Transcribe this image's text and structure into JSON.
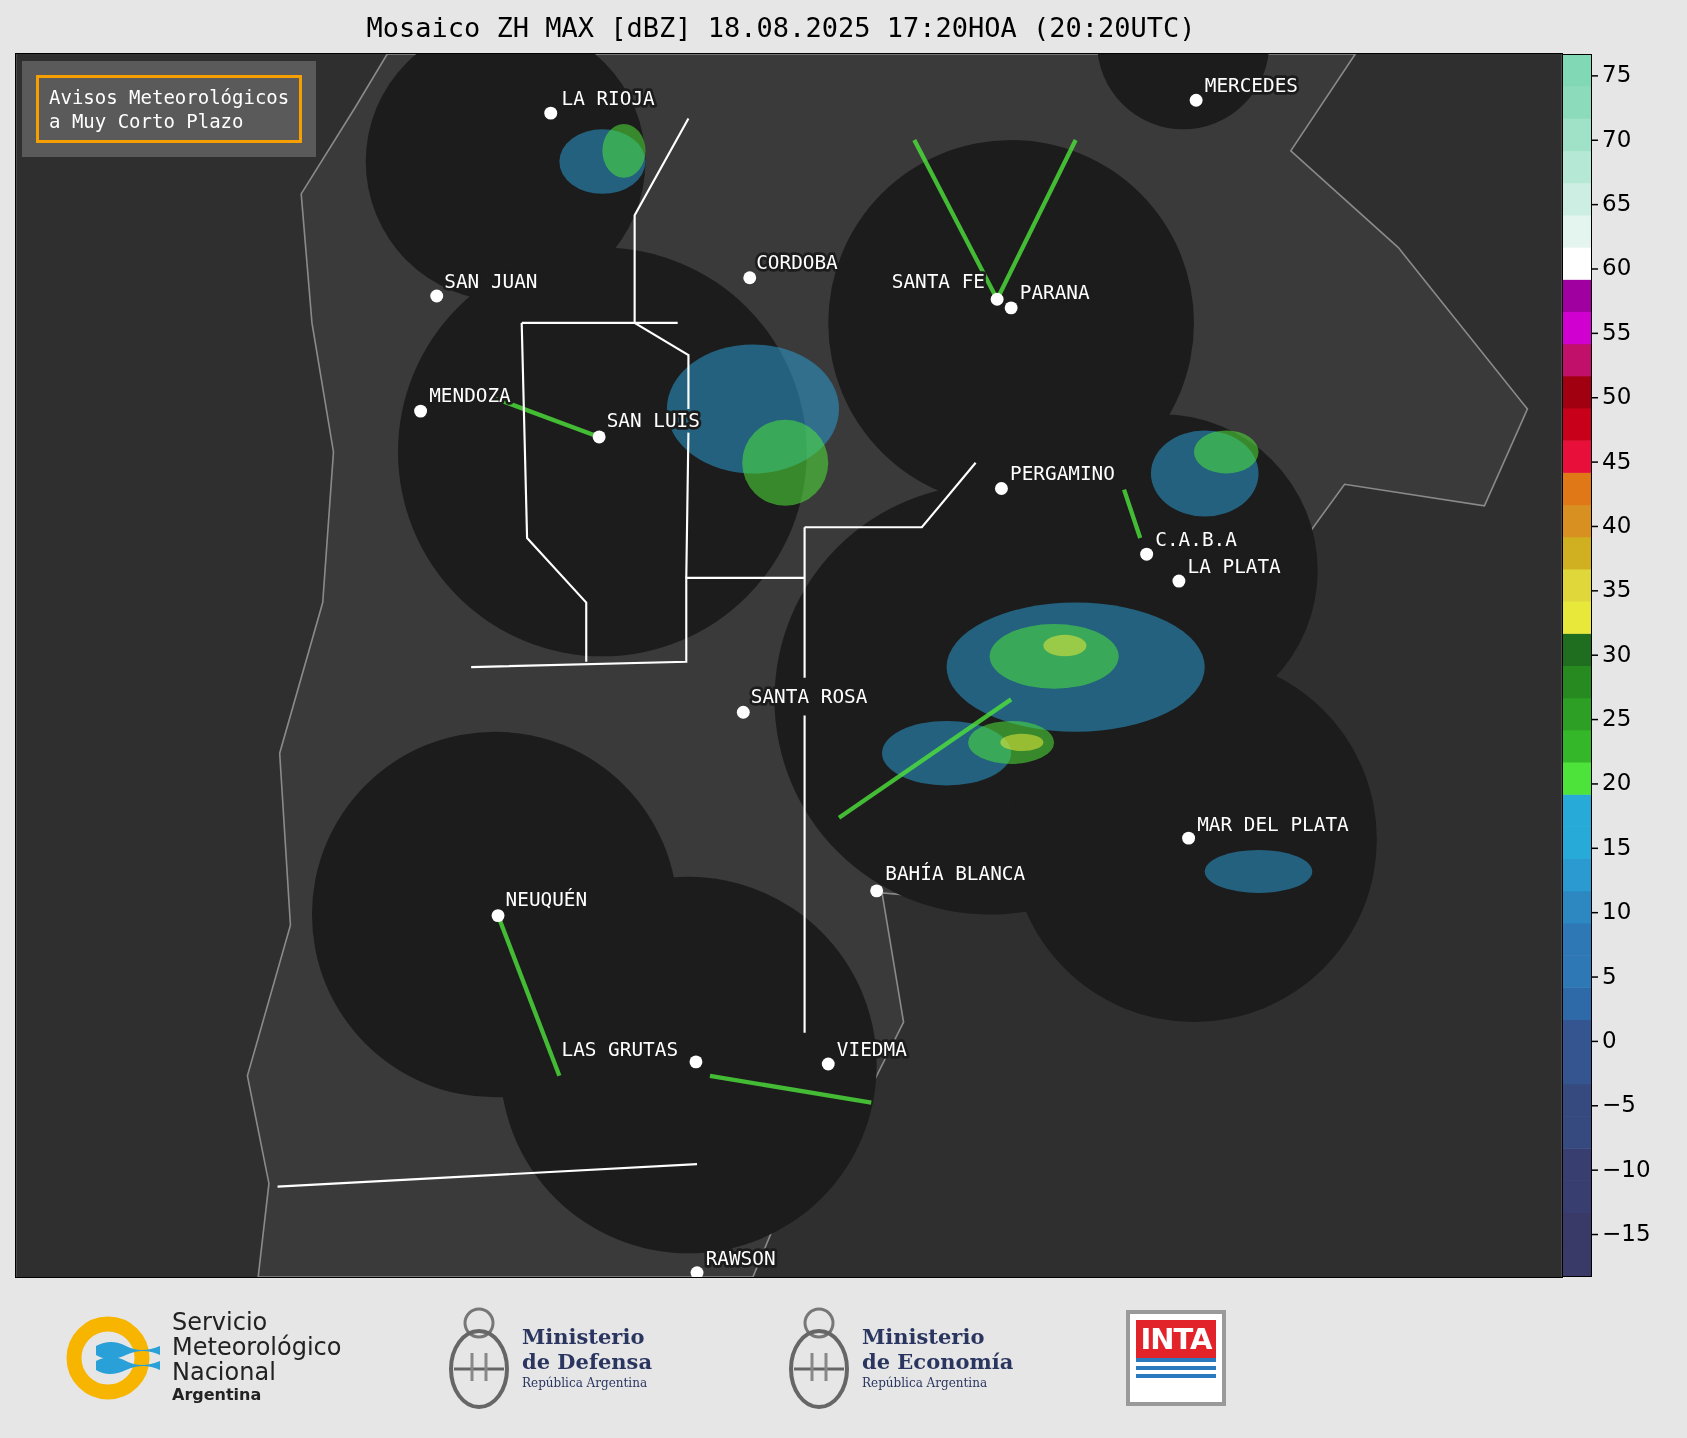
{
  "title": "Mosaico ZH MAX [dBZ] 18.08.2025 17:20HOA (20:20UTC)",
  "notice_box": {
    "lines": [
      "Avisos Meteorológicos",
      "a Muy Corto Plazo"
    ]
  },
  "cities": [
    {
      "name": "LA RIOJA"
    },
    {
      "name": "MERCEDES"
    },
    {
      "name": "CORDOBA"
    },
    {
      "name": "SAN JUAN"
    },
    {
      "name": "SANTA FE"
    },
    {
      "name": "PARANA"
    },
    {
      "name": "MENDOZA"
    },
    {
      "name": "SAN LUIS"
    },
    {
      "name": "PERGAMINO"
    },
    {
      "name": "C.A.B.A"
    },
    {
      "name": "LA PLATA"
    },
    {
      "name": "SANTA ROSA"
    },
    {
      "name": "MAR DEL PLATA"
    },
    {
      "name": "BAHÍA BLANCA"
    },
    {
      "name": "NEUQUÉN"
    },
    {
      "name": "LAS GRUTAS"
    },
    {
      "name": "VIEDMA"
    },
    {
      "name": "RAWSON"
    }
  ],
  "colorbar": {
    "ticks": [
      "75",
      "70",
      "65",
      "60",
      "55",
      "50",
      "45",
      "40",
      "35",
      "30",
      "25",
      "20",
      "15",
      "10",
      "5",
      "0",
      "−5",
      "−10",
      "−15"
    ]
  },
  "footer": {
    "logos": [
      {
        "kind": "smn",
        "lines": [
          "Servicio",
          "Meteorológico",
          "Nacional",
          "Argentina"
        ]
      },
      {
        "kind": "ministry",
        "lines": [
          "Ministerio",
          "de Defensa",
          "República Argentina"
        ]
      },
      {
        "kind": "ministry",
        "lines": [
          "Ministerio",
          "de Economía",
          "República Argentina"
        ]
      },
      {
        "kind": "inta",
        "lines": [
          "INTA"
        ]
      }
    ]
  }
}
